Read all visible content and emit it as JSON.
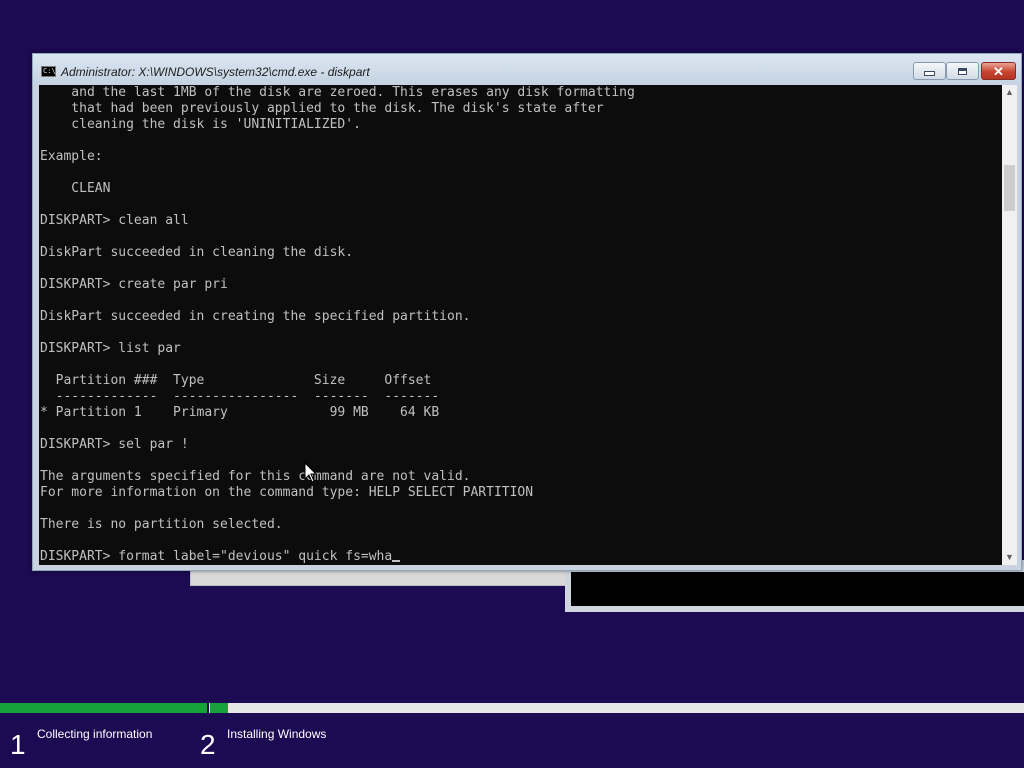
{
  "window": {
    "title": "Administrator: X:\\WINDOWS\\system32\\cmd.exe - diskpart",
    "title_icon_text": "C:\\",
    "minimize_icon": "minimize-icon",
    "maximize_icon": "maximize-icon",
    "close_icon": "close-icon",
    "close_symbol": "✕"
  },
  "console": {
    "lines": [
      "    and the last 1MB of the disk are zeroed. This erases any disk formatting",
      "    that had been previously applied to the disk. The disk's state after",
      "    cleaning the disk is 'UNINITIALIZED'.",
      "",
      "Example:",
      "",
      "    CLEAN",
      "",
      "DISKPART> clean all",
      "",
      "DiskPart succeeded in cleaning the disk.",
      "",
      "DISKPART> create par pri",
      "",
      "DiskPart succeeded in creating the specified partition.",
      "",
      "DISKPART> list par",
      "",
      "  Partition ###  Type              Size     Offset",
      "  -------------  ----------------  -------  -------",
      "* Partition 1    Primary             99 MB    64 KB",
      "",
      "DISKPART> sel par !",
      "",
      "The arguments specified for this command are not valid.",
      "For more information on the command type: HELP SELECT PARTITION",
      "",
      "There is no partition selected.",
      ""
    ],
    "current_command": "DISKPART> format label=\"devious\" quick fs=wha"
  },
  "scrollbar": {
    "up_arrow": "▲",
    "down_arrow": "▼"
  },
  "setup_progress": {
    "step1_fill": 0.2,
    "step2_fill": 0.015,
    "steps": [
      {
        "number": "1",
        "label": "Collecting information"
      },
      {
        "number": "2",
        "label": "Installing Windows"
      }
    ]
  },
  "colors": {
    "desktop_bg": "#1c0a52",
    "progress": "#17a33c",
    "console_bg": "#0c0c0c",
    "console_text": "#c0c0c0"
  }
}
